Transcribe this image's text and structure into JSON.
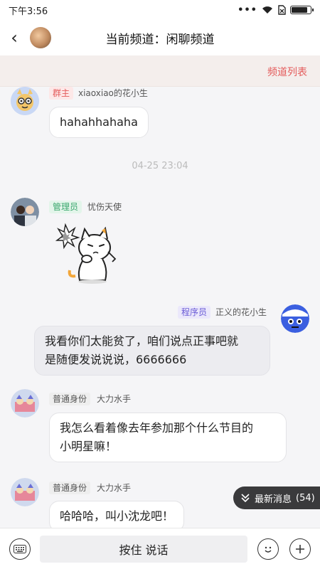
{
  "status": {
    "time": "下午3:56",
    "dots": "•••",
    "battery_level": 0.92
  },
  "header": {
    "back": "‹",
    "title": "当前频道：闲聊频道"
  },
  "subbar": {
    "channel_list": "频道列表"
  },
  "messages": [
    {
      "badge": "群主",
      "name": "xiaoxiao的花小生",
      "text": "hahahhahaha"
    },
    {
      "badge": "管理员",
      "name": "忧伤天使"
    },
    {
      "badge": "程序员",
      "name": "正义的花小生",
      "text_line1": "我看你们太能贫了，咱们说点正事吧就",
      "text_line2": "是随便发说说说，6666666"
    },
    {
      "badge": "普通身份",
      "name": "大力水手",
      "text_line1": "我怎么看着像去年参加那个什么节目的",
      "text_line2": "小明星嘛！"
    },
    {
      "badge": "普通身份",
      "name": "大力水手",
      "text": "哈哈哈，叫小沈龙吧！"
    }
  ],
  "timestamp": "04-25 23:04",
  "new_messages": {
    "label": "最新消息",
    "count": "(54)"
  },
  "input": {
    "hold_label": "按住 说话"
  },
  "colors": {
    "accent": "#e45b5b",
    "owner_badge_bg": "#fde8e8",
    "admin_badge_bg": "#e3f5ea",
    "dev_badge_bg": "#ebe8fb",
    "normal_badge_bg": "#eeeeee"
  }
}
